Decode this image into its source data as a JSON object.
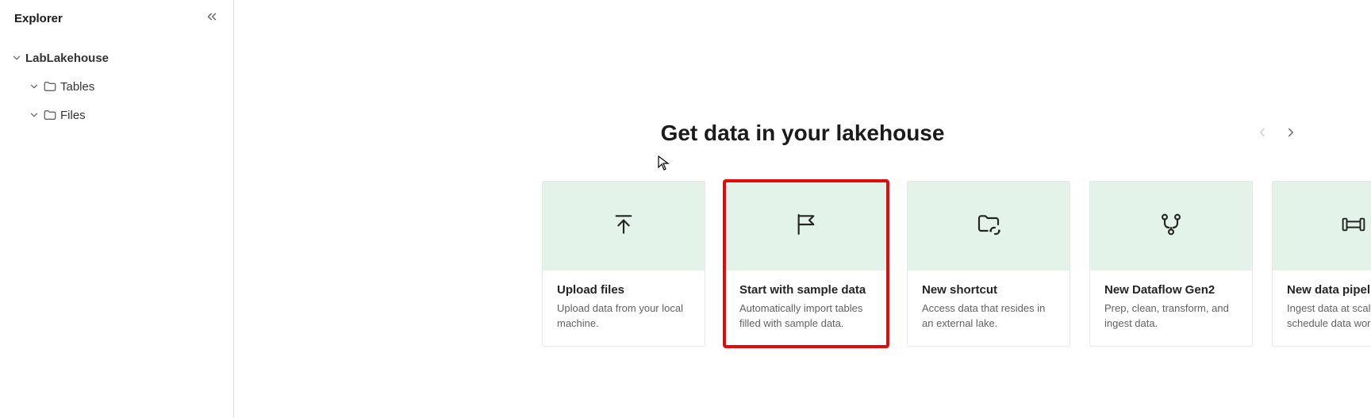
{
  "sidebar": {
    "title": "Explorer",
    "root_label": "LabLakehouse",
    "items": [
      {
        "label": "Tables"
      },
      {
        "label": "Files"
      }
    ]
  },
  "main": {
    "title": "Get data in your lakehouse"
  },
  "cards": [
    {
      "icon": "upload",
      "title": "Upload files",
      "desc": "Upload data from your local machine.",
      "highlighted": false
    },
    {
      "icon": "flag",
      "title": "Start with sample data",
      "desc": "Automatically import tables filled with sample data.",
      "highlighted": true
    },
    {
      "icon": "shortcut",
      "title": "New shortcut",
      "desc": "Access data that resides in an external lake.",
      "highlighted": false
    },
    {
      "icon": "dataflow",
      "title": "New Dataflow Gen2",
      "desc": "Prep, clean, transform, and ingest data.",
      "highlighted": false
    },
    {
      "icon": "pipeline",
      "title": "New data pipeline",
      "desc": "Ingest data at scale and schedule data workflows.",
      "highlighted": false
    }
  ]
}
